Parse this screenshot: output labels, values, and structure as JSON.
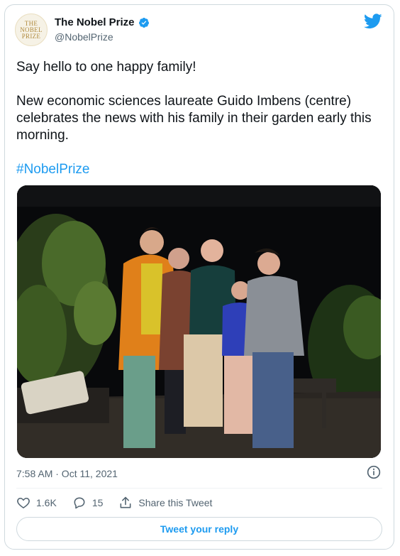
{
  "author": {
    "avatar_lines": [
      "THE",
      "NOBEL",
      "PRIZE"
    ],
    "display_name": "The Nobel Prize",
    "handle": "@NobelPrize",
    "verified": true
  },
  "tweet": {
    "line1": "Say hello to one happy family!",
    "line2": "New economic sciences laureate Guido Imbens (centre) celebrates the news with his family in their garden early this morning.",
    "hashtag": "#NobelPrize"
  },
  "meta": {
    "timestamp": "7:58 AM · Oct 11, 2021"
  },
  "actions": {
    "likes": "1.6K",
    "replies": "15",
    "share_label": "Share this Tweet"
  },
  "reply_button": "Tweet your reply",
  "colors": {
    "accent": "#1d9bf0",
    "text": "#0f1419",
    "muted": "#536471",
    "border": "#cfd9de"
  },
  "icons": [
    "twitter-bird-icon",
    "verified-badge-icon",
    "info-icon",
    "heart-icon",
    "reply-icon",
    "share-icon"
  ]
}
